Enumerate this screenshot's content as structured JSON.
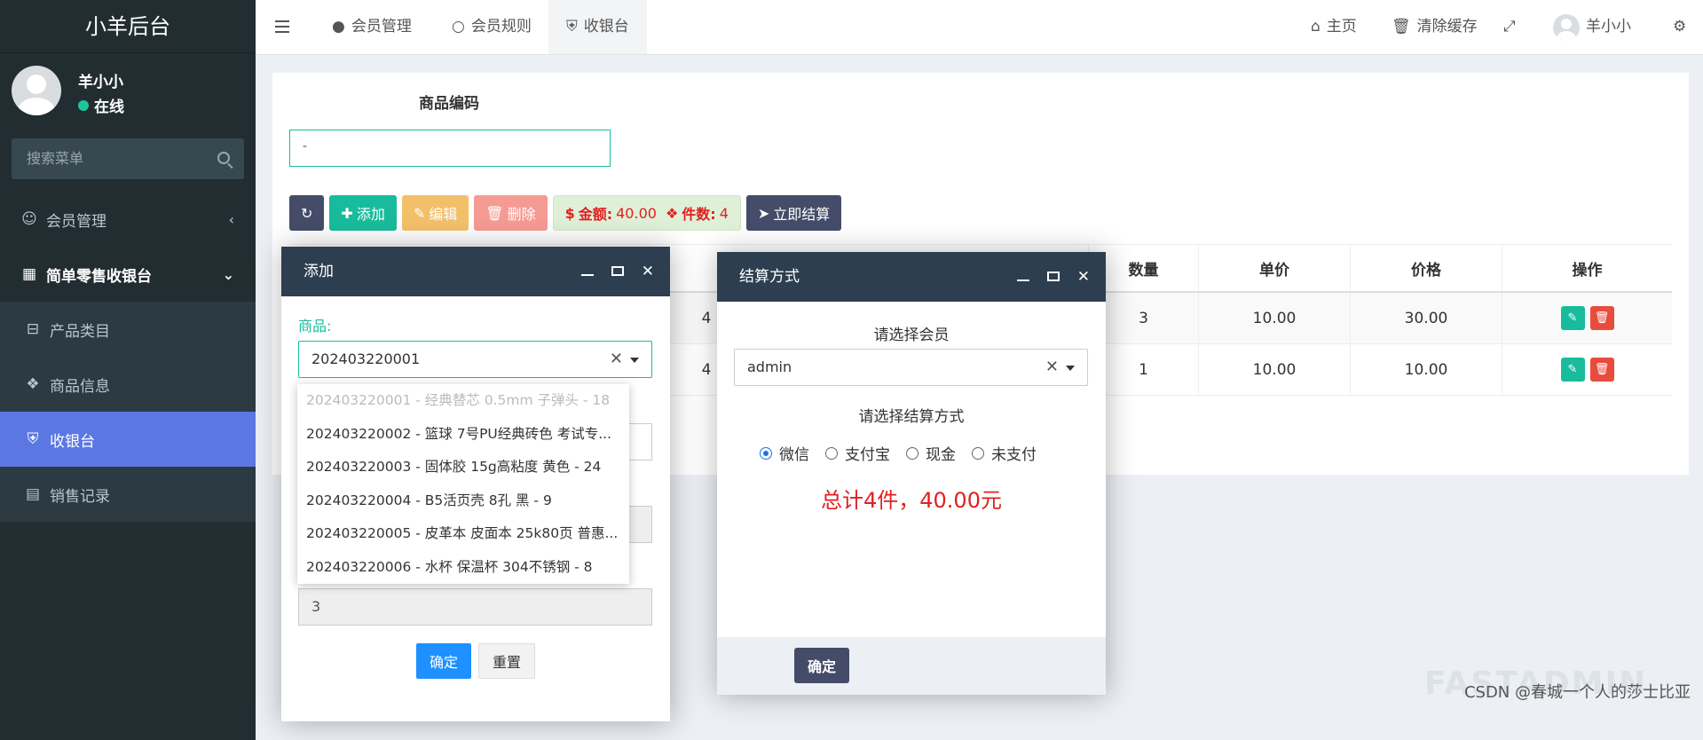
{
  "sidebar": {
    "brand": "小羊后台",
    "user_name": "羊小小",
    "user_status": "在线",
    "search_placeholder": "搜索菜单",
    "items": [
      {
        "label": "会员管理",
        "icon": "user-circle-icon"
      },
      {
        "label": "简单零售收银台",
        "icon": "map-icon"
      },
      {
        "label": "产品类目",
        "icon": "minus-square-icon"
      },
      {
        "label": "商品信息",
        "icon": "cubes-icon"
      },
      {
        "label": "收银台",
        "icon": "shield-icon"
      },
      {
        "label": "销售记录",
        "icon": "file-text-icon"
      }
    ]
  },
  "navbar": {
    "tabs": [
      {
        "label": "会员管理"
      },
      {
        "label": "会员规则"
      },
      {
        "label": "收银台"
      }
    ],
    "home": "主页",
    "clear_cache": "清除缓存",
    "user": "羊小小"
  },
  "main": {
    "code_label": "商品编码",
    "code_value": "-",
    "toolbar": {
      "add": "添加",
      "edit": "编辑",
      "delete": "删除",
      "amount_label": "金额:",
      "amount_value": "40.00",
      "count_label": "件数:",
      "count_value": "4",
      "checkout": "立即结算"
    },
    "table": {
      "headers": [
        "数量",
        "单价",
        "价格",
        "操作"
      ],
      "rows": [
        {
          "partial": "4",
          "qty": "3",
          "unit": "10.00",
          "price": "30.00"
        },
        {
          "partial": "4",
          "qty": "1",
          "unit": "10.00",
          "price": "10.00"
        }
      ]
    }
  },
  "add_dialog": {
    "title": "添加",
    "product_label": "商品:",
    "selected": "202403220001",
    "options": [
      "202403220001 - 经典替芯 0.5mm 子弹头 - 18",
      "202403220002 - 篮球 7号PU经典砖色 考试专...",
      "202403220003 - 固体胶 15g高粘度 黄色 - 24",
      "202403220004 - B5活页壳 8孔 黑 - 9",
      "202403220005 - 皮革本 皮面本 25k80页 普惠...",
      "202403220006 - 水杯 保温杯 304不锈钢 - 8"
    ],
    "qty_value": "3",
    "confirm": "确定",
    "reset": "重置"
  },
  "pay_dialog": {
    "title": "结算方式",
    "member_label": "请选择会员",
    "member_value": "admin",
    "method_label": "请选择结算方式",
    "methods": [
      "微信",
      "支付宝",
      "现金",
      "未支付"
    ],
    "total": "总计4件，40.00元",
    "confirm": "确定"
  },
  "watermark": "FASTADMIN",
  "footer_credit": "CSDN @春城一个人的莎士比亚",
  "colors": {
    "sidebar_bg": "#222d32",
    "active_menu": "#5b78e2",
    "accent_green": "#18bc9c",
    "danger": "#e74c3c",
    "dialog_title_bg": "#2c3e50"
  }
}
